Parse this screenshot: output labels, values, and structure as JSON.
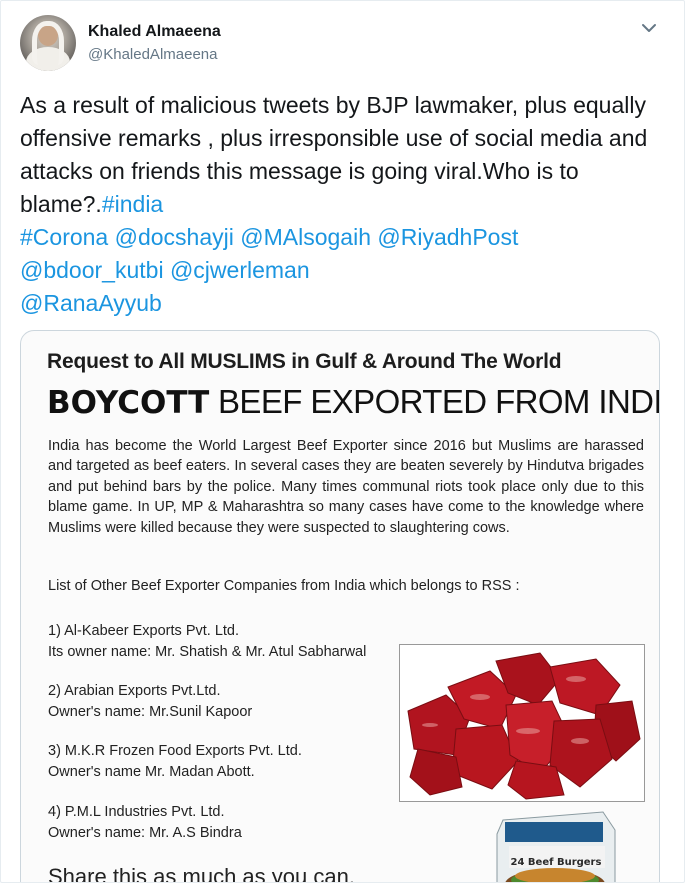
{
  "tweet": {
    "author_name": "Khaled Almaeena",
    "author_handle": "@KhaledAlmaeena",
    "menu_icon": "chevron-down-icon",
    "text_part1": "As a result of malicious tweets by BJP lawmaker, plus equally offensive remarks , plus irresponsible use of social media and attacks on friends this message is going viral.Who is to blame?.",
    "hashtag_india": "#india",
    "hashtag_corona": "#Corona",
    "mention_docshayji": "@docshayji",
    "mention_malsogaih": "@MAlsogaih",
    "mention_riyadhpost": "@RiyadhPost",
    "mention_bdoor_kutbi": "@bdoor_kutbi",
    "mention_cjwerleman": "@cjwerleman",
    "mention_ranaayyub": "@RanaAyyub"
  },
  "poster": {
    "heading": "Request to All MUSLIMS in Gulf & Around The World",
    "boycott_word": "BOYCOTT",
    "boycott_rest": "BEEF EXPORTED FROM INDIA",
    "paragraph": "India has become the World Largest Beef Exporter since 2016 but Muslims are harassed and targeted as beef eaters. In several cases they are beaten severely by Hindutva brigades and put behind bars by the  police. Many times communal riots took place only due to this blame game. In UP, MP & Maharashtra so many cases have come to the knowledge where Muslims were killed because they were suspected to slaughtering cows.",
    "list_title": "List of Other Beef Exporter Companies from India which belongs to RSS :",
    "items": [
      {
        "company": "1) Al-Kabeer Exports Pvt. Ltd.",
        "owner": "Its owner name: Mr. Shatish & Mr. Atul Sabharwal"
      },
      {
        "company": "2) Arabian Exports Pvt.Ltd.",
        "owner": "Owner's name: Mr.Sunil Kapoor"
      },
      {
        "company": "3) M.K.R Frozen Food Exports Pvt. Ltd.",
        "owner": "Owner's name Mr. Madan Abott."
      },
      {
        "company": "4) P.M.L Industries Pvt. Ltd.",
        "owner": "Owner's name: Mr. A.S Bindra"
      }
    ],
    "share_text": "Share this as much as you can.",
    "burger_box_label": "24 Beef Burgers"
  },
  "colors": {
    "link": "#1b95e0",
    "text": "#14171a",
    "secondary": "#657786",
    "border": "#e6ecf0"
  }
}
